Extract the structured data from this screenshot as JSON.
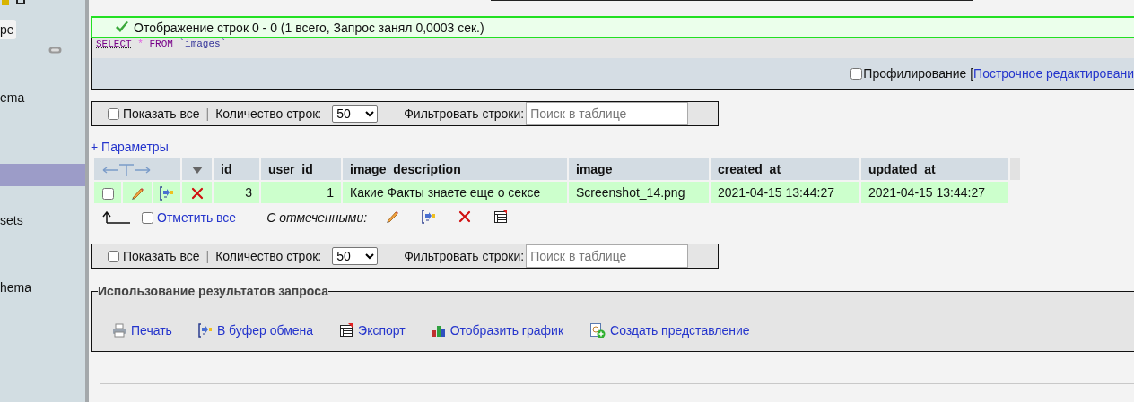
{
  "sidebar": {
    "button_label": "ре",
    "items": [
      {
        "label": "ema",
        "selected": false
      },
      {
        "selected": true
      },
      {
        "label": "sets",
        "selected": false
      },
      {
        "label": "hema",
        "selected": false
      }
    ]
  },
  "message": {
    "kind": "success",
    "text": "Отображение строк 0 - 0 (1 всего, Запрос занял 0,0003 сек.)"
  },
  "sql": [
    {
      "text": "SELECT",
      "kind": "keyword"
    },
    {
      "text": "*",
      "kind": "operator"
    },
    {
      "text": "FROM",
      "kind": "keyword"
    },
    {
      "text": "`images`",
      "kind": "identifier"
    }
  ],
  "query_options": {
    "profiling": {
      "label": "Профилирование",
      "checked": false
    },
    "bracket": "[",
    "inline_edit": "Построчное редактировани"
  },
  "navigation_bars": [
    {
      "show_all": {
        "label": "Показать все",
        "checked": false
      },
      "separator": "|",
      "rows_label": "Количество строк:",
      "rows_value": "50",
      "filter_label": "Фильтровать строки:",
      "filter_placeholder": "Поиск в таблице"
    },
    {
      "show_all": {
        "label": "Показать все",
        "checked": false
      },
      "separator": "|",
      "rows_label": "Количество строк:",
      "rows_value": "50",
      "filter_label": "Фильтровать строки:",
      "filter_placeholder": "Поиск в таблице"
    }
  ],
  "options_link": "+ Параметры",
  "table": {
    "columns": [
      {
        "label": "id",
        "kind": "number"
      },
      {
        "label": "user_id",
        "kind": "number"
      },
      {
        "label": "image_description",
        "kind": "text"
      },
      {
        "label": "image",
        "kind": "text"
      },
      {
        "label": "created_at",
        "kind": "text"
      },
      {
        "label": "updated_at",
        "kind": "text"
      }
    ],
    "rows": [
      {
        "checked": false,
        "cells": [
          "3",
          "1",
          "Какие Факты знаете еще о сексе",
          "Screenshot_14.png",
          "2021-04-15 13:44:27",
          "2021-04-15 13:44:27"
        ]
      }
    ]
  },
  "with_selected": {
    "check_all": {
      "label": "Отметить все",
      "checked": false
    },
    "label": "С отмеченными:",
    "actions": [
      {
        "kind": "edit"
      },
      {
        "kind": "copy"
      },
      {
        "kind": "delete"
      },
      {
        "kind": "export"
      }
    ]
  },
  "operations": {
    "legend": "Использование результатов запроса",
    "links": [
      {
        "kind": "print",
        "label": "Печать"
      },
      {
        "kind": "copy",
        "label": "В буфер обмена"
      },
      {
        "kind": "export",
        "label": "Экспорт"
      },
      {
        "kind": "chart",
        "label": "Отобразить график"
      },
      {
        "kind": "view",
        "label": "Создать представление"
      }
    ]
  }
}
